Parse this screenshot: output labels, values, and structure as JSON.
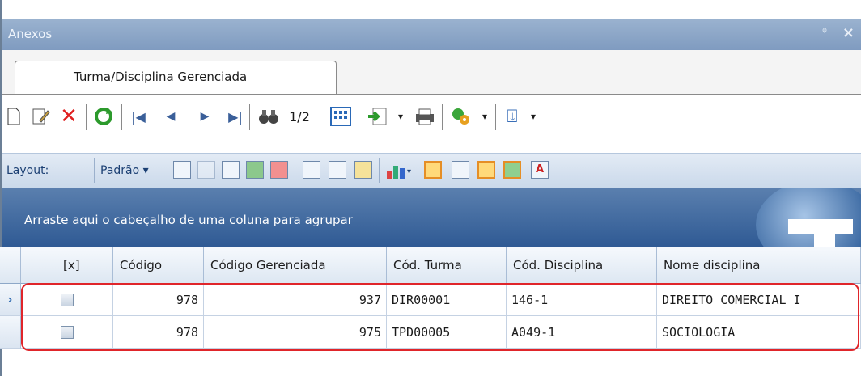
{
  "window": {
    "title": "Anexos",
    "pin_glyph": "ᵠ",
    "close_glyph": "×"
  },
  "tabs": [
    {
      "label": "Turma/Disciplina Gerenciada"
    }
  ],
  "navigator": {
    "position": "1/2"
  },
  "layout_bar": {
    "label": "Layout:",
    "preset": "Padrão ▾"
  },
  "group_panel": {
    "text": "Arraste aqui o cabeçalho de uma coluna para agrupar"
  },
  "grid": {
    "columns": [
      "[x]",
      "Código",
      "Código Gerenciada",
      "Cód. Turma",
      "Cód. Disciplina",
      "Nome disciplina"
    ],
    "rows": [
      {
        "selected": false,
        "codigo": "978",
        "codigo_gerenciada": "937",
        "cod_turma": "DIR00001",
        "cod_disciplina": "146-1",
        "nome_disciplina": "DIREITO COMERCIAL I",
        "current": true
      },
      {
        "selected": false,
        "codigo": "978",
        "codigo_gerenciada": "975",
        "cod_turma": "TPD00005",
        "cod_disciplina": "A049-1",
        "nome_disciplina": "SOCIOLOGIA",
        "current": false
      }
    ]
  },
  "colors": {
    "title_bar": "#8ba6c8",
    "group_panel": "#3d679f",
    "highlight": "#e0252a"
  }
}
